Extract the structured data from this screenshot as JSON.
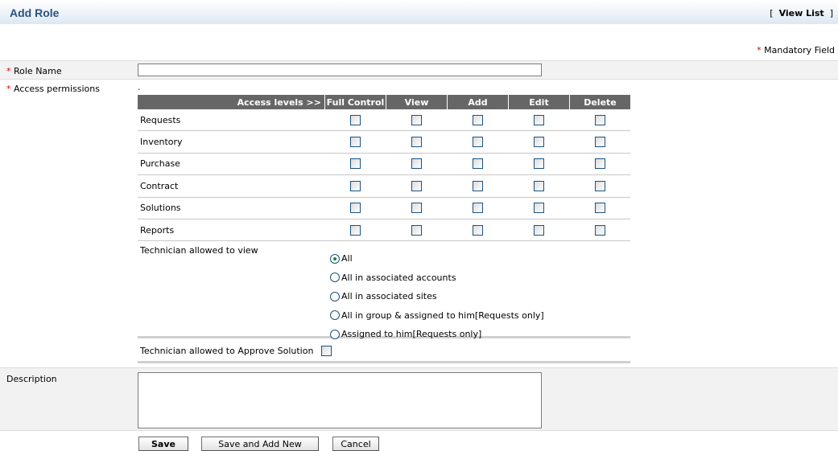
{
  "header": {
    "title": "Add Role",
    "view_list_prefix": "[",
    "view_list_label": "View List",
    "view_list_suffix": "]"
  },
  "mandatory_note": {
    "asterisk": "*",
    "text": "Mandatory Field"
  },
  "role_name": {
    "asterisk": "*",
    "label": "Role Name",
    "value": ""
  },
  "access": {
    "asterisk": "*",
    "label": "Access permissions",
    "dot": ".",
    "header_label": "Access levels >>",
    "columns": [
      "Full Control",
      "View",
      "Add",
      "Edit",
      "Delete"
    ],
    "modules": [
      "Requests",
      "Inventory",
      "Purchase",
      "Contract",
      "Solutions",
      "Reports"
    ]
  },
  "technician_view": {
    "label": "Technician allowed to view",
    "options": [
      "All",
      "All in associated accounts",
      "All in associated sites",
      "All in group & assigned to him[Requests only]",
      "Assigned to him[Requests only]"
    ],
    "selected_index": 0
  },
  "approve_solution": {
    "label": "Technician allowed to Approve Solution",
    "checked": false
  },
  "description": {
    "label": "Description",
    "value": ""
  },
  "buttons": {
    "save": "Save",
    "save_add_new": "Save and Add New",
    "cancel": "Cancel"
  }
}
